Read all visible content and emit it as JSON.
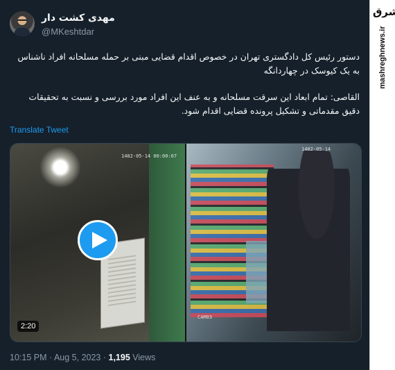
{
  "tweet": {
    "author_name": "مهدی کشت دار",
    "handle": "@MKeshtdar",
    "paragraphs": [
      "دستور رئیس کل دادگستری تهران در خصوص اقدام قضایی مبنی بر حمله مسلحانه افراد ناشناس به یک کیوسک در چهاردانگه",
      "القاصی: تمام ابعاد این سرقت مسلحانه و به عنف این افراد مورد بررسی و نسبت به تحقیقات دقیق مقدماتی و تشکیل پرونده قضایی اقدام شود."
    ],
    "translate_label": "Translate Tweet",
    "video": {
      "duration": "2:20",
      "left_timestamp": "1402-05-14 00:00:07",
      "right_timestamp": "1402-05-14",
      "right_cam_label": "CAM03",
      "play_icon": "play-icon"
    },
    "time": "10:15 PM",
    "date": "Aug 5, 2023",
    "views_count": "1,195",
    "views_label": "Views"
  },
  "watermark": {
    "logo_text": "مشرق",
    "site": "mashreghnews.ir"
  },
  "colors": {
    "background": "#15202b",
    "accent": "#1d9bf0",
    "secondary_text": "#8b98a5"
  }
}
